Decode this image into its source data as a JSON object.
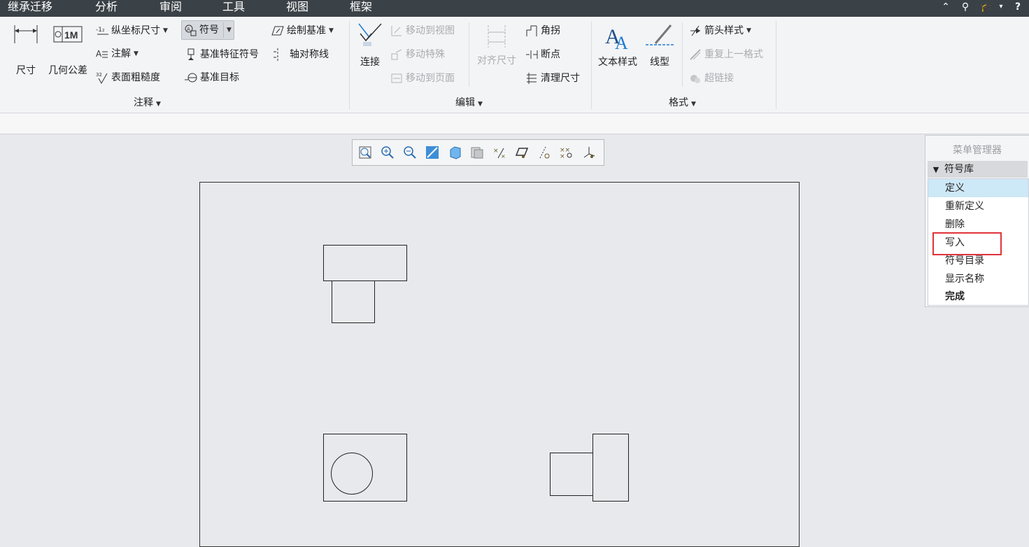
{
  "menu_tabs": [
    "继承迁移",
    "分析",
    "审阅",
    "工具",
    "视图",
    "框架"
  ],
  "top_icons": [
    "⌃",
    "⚲",
    "🎓",
    "▾",
    "?"
  ],
  "ribbon": {
    "annotate": {
      "dimension": "尺寸",
      "geometric_tolerance": "几何公差",
      "ordinate_dimension": "纵坐标尺寸",
      "note": "注解",
      "surface_finish": "表面粗糙度",
      "symbol": "符号",
      "datum_feature_symbol": "基准特征符号",
      "datum_target": "基准目标",
      "sketch_datum": "绘制基准",
      "axis_of_symmetry": "轴对称线",
      "group_label": "注释"
    },
    "edit": {
      "connect": "连接",
      "move_to_view": "移动到视图",
      "move_special": "移动特殊",
      "move_to_page": "移动到页面",
      "align_dimensions": "对齐尺寸",
      "jog": "角拐",
      "break": "断点",
      "cleanup_dimensions": "清理尺寸",
      "group_label": "编辑"
    },
    "format": {
      "text_style": "文本样式",
      "line_style": "线型",
      "arrow_style": "箭头样式",
      "repeat_last_format": "重复上一格式",
      "hyperlink": "超链接",
      "group_label": "格式"
    }
  },
  "menu_manager": {
    "title": "菜单管理器",
    "header": "符号库",
    "items": [
      "定义",
      "重新定义",
      "删除",
      "写入",
      "符号目录",
      "显示名称",
      "完成"
    ],
    "selected_index": 0,
    "highlighted_index": 3
  },
  "colors": {
    "accent_highlight": "#e0333a",
    "selected_bg": "#cde8f6",
    "topbar": "#3b4247"
  }
}
